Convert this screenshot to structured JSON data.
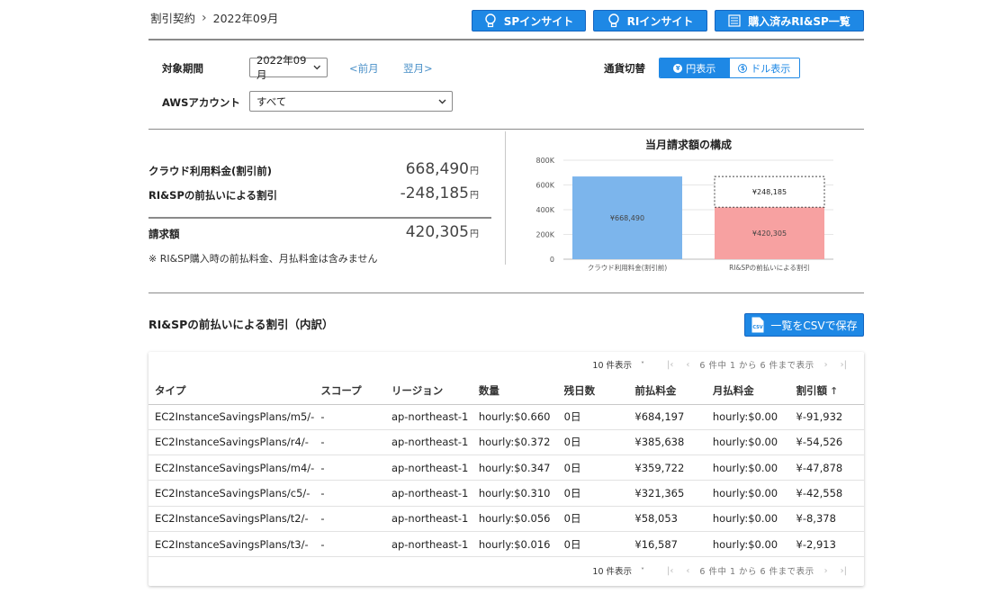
{
  "breadcrumb": {
    "parent": "割引契約",
    "separator": "›",
    "current": "2022年09月"
  },
  "header_buttons": {
    "sp_insight": "SPインサイト",
    "ri_insight": "RIインサイト",
    "purchased_list": "購入済みRI&SP一覧"
  },
  "filters": {
    "period_label": "対象期間",
    "period_value": "2022年09月",
    "prev_month": "<前月",
    "next_month": "翌月>",
    "account_label": "AWSアカウント",
    "account_value": "すべて",
    "currency_label": "通貨切替",
    "currency_yen": "円表示",
    "currency_usd": "ドル表示",
    "yen_glyph": "¥",
    "usd_glyph": "$"
  },
  "summary": {
    "cloud_label": "クラウド利用料金(割引前)",
    "cloud_value": "668,490",
    "discount_label": "RI&SPの前払いによる割引",
    "discount_value": "-248,185",
    "billing_label": "請求額",
    "billing_value": "420,305",
    "unit": "円",
    "note": "※ RI&SP購入時の前払料金、月払料金は含みません"
  },
  "chart_data": {
    "type": "bar",
    "title": "当月請求額の構成",
    "categories": [
      "クラウド利用料金(割引前)",
      "RI&SPの前払いによる割引"
    ],
    "y_ticks": [
      "0",
      "200K",
      "400K",
      "600K",
      "800K"
    ],
    "ylim": [
      0,
      800000
    ],
    "bars": [
      {
        "category": "クラウド利用料金(割引前)",
        "value": 668490,
        "label": "¥668,490",
        "color": "#7cb5ec"
      },
      {
        "category": "RI&SPの前払いによる割引",
        "value": 420305,
        "label": "¥420,305",
        "color": "#f7a1a1"
      }
    ],
    "stacked_dashed": {
      "category": "RI&SPの前払いによる割引",
      "base": 420305,
      "value": 248185,
      "label": "¥248,185"
    },
    "grid": true
  },
  "breakdown": {
    "title": "RI&SPの前払いによる割引（内訳）",
    "csv_button": "一覧をCSVで保存",
    "csv_icon_text": "CSV",
    "pager": {
      "per_page": "10 件表示",
      "range": "6 件中 1 から 6 件まで表示"
    },
    "columns": [
      "タイプ",
      "スコープ",
      "リージョン",
      "数量",
      "残日数",
      "前払料金",
      "月払料金",
      "割引額"
    ],
    "sort_indicator": "↑",
    "rows": [
      [
        "EC2InstanceSavingsPlans/m5/-",
        "-",
        "ap-northeast-1",
        "hourly:$0.660",
        "0日",
        "¥684,197",
        "hourly:$0.00",
        "¥-91,932"
      ],
      [
        "EC2InstanceSavingsPlans/r4/-",
        "-",
        "ap-northeast-1",
        "hourly:$0.372",
        "0日",
        "¥385,638",
        "hourly:$0.00",
        "¥-54,526"
      ],
      [
        "EC2InstanceSavingsPlans/m4/-",
        "-",
        "ap-northeast-1",
        "hourly:$0.347",
        "0日",
        "¥359,722",
        "hourly:$0.00",
        "¥-47,878"
      ],
      [
        "EC2InstanceSavingsPlans/c5/-",
        "-",
        "ap-northeast-1",
        "hourly:$0.310",
        "0日",
        "¥321,365",
        "hourly:$0.00",
        "¥-42,558"
      ],
      [
        "EC2InstanceSavingsPlans/t2/-",
        "-",
        "ap-northeast-1",
        "hourly:$0.056",
        "0日",
        "¥58,053",
        "hourly:$0.00",
        "¥-8,378"
      ],
      [
        "EC2InstanceSavingsPlans/t3/-",
        "-",
        "ap-northeast-1",
        "hourly:$0.016",
        "0日",
        "¥16,587",
        "hourly:$0.00",
        "¥-2,913"
      ]
    ]
  }
}
